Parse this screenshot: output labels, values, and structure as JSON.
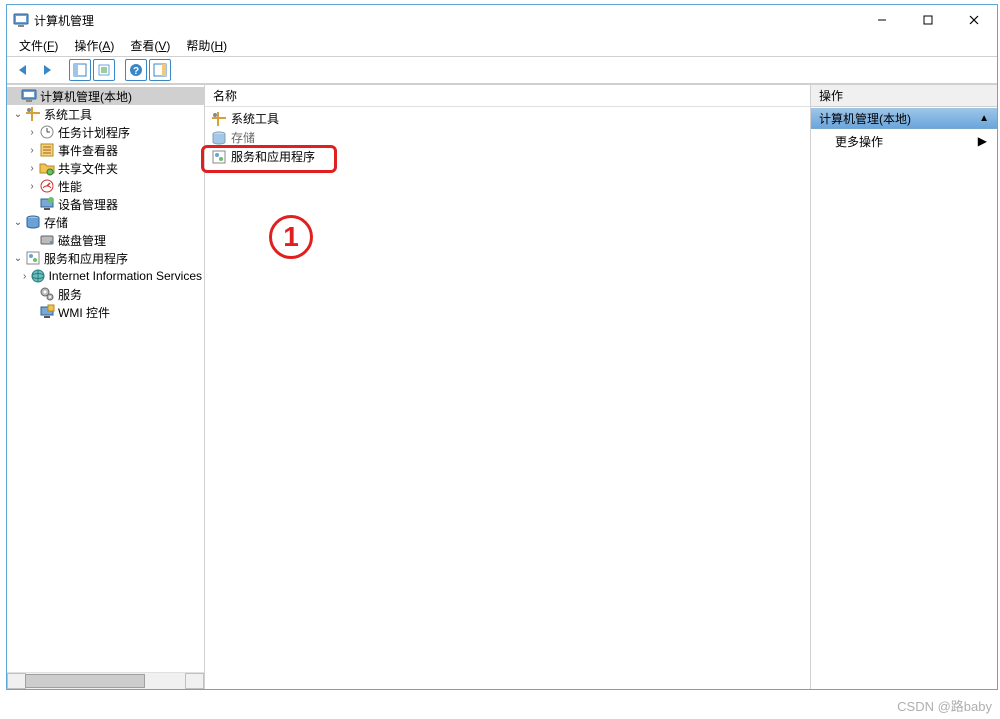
{
  "window": {
    "title": "计算机管理",
    "controls": {
      "minimize": "—",
      "maximize": "□",
      "close": "✕"
    }
  },
  "menu": {
    "file": {
      "label": "文件",
      "hotkey": "F"
    },
    "action": {
      "label": "操作",
      "hotkey": "A"
    },
    "view": {
      "label": "查看",
      "hotkey": "V"
    },
    "help": {
      "label": "帮助",
      "hotkey": "H"
    }
  },
  "tree": {
    "root": "计算机管理(本地)",
    "system_tools": "系统工具",
    "task_scheduler": "任务计划程序",
    "event_viewer": "事件查看器",
    "shared_folders": "共享文件夹",
    "performance": "性能",
    "device_manager": "设备管理器",
    "storage": "存储",
    "disk_management": "磁盘管理",
    "services_apps": "服务和应用程序",
    "iis": "Internet Information Services",
    "services": "服务",
    "wmi": "WMI 控件"
  },
  "list": {
    "header": "名称",
    "items": [
      {
        "label": "系统工具",
        "icon": "tools"
      },
      {
        "label": "存储",
        "icon": "storage"
      },
      {
        "label": "服务和应用程序",
        "icon": "services"
      }
    ]
  },
  "actions": {
    "header": "操作",
    "context": "计算机管理(本地)",
    "more": "更多操作"
  },
  "annotation": {
    "marker": "1"
  },
  "watermark": "CSDN @路baby"
}
